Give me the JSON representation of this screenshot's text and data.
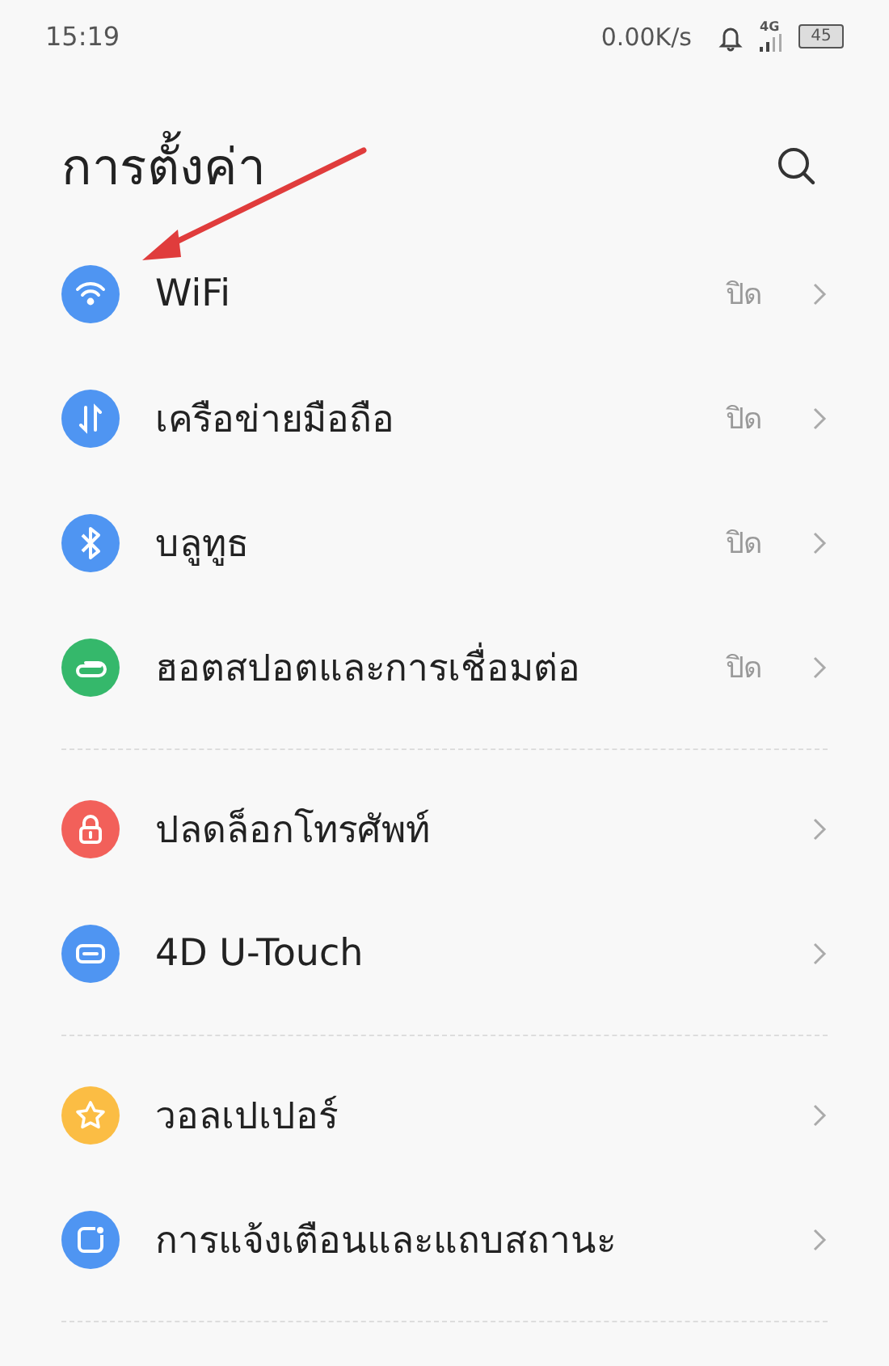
{
  "status_bar": {
    "time": "15:19",
    "speed": "0.00K/s",
    "network": "4G",
    "battery": "45"
  },
  "title": "การตั้งค่า",
  "sections": [
    {
      "items": [
        {
          "kind": "wifi",
          "label": "WiFi",
          "value": "ปิด",
          "color": "#4f95f2"
        },
        {
          "kind": "data",
          "label": "เครือข่ายมือถือ",
          "value": "ปิด",
          "color": "#4f95f2"
        },
        {
          "kind": "bluetooth",
          "label": "บลูทูธ",
          "value": "ปิด",
          "color": "#4f95f2"
        },
        {
          "kind": "hotspot",
          "label": "ฮอตสปอตและการเชื่อมต่อ",
          "value": "ปิด",
          "color": "#35b86b"
        }
      ]
    },
    {
      "items": [
        {
          "kind": "lock",
          "label": "ปลดล็อกโทรศัพท์",
          "color": "#f2605a"
        },
        {
          "kind": "touch",
          "label": "4D U-Touch",
          "color": "#4f95f2"
        }
      ]
    },
    {
      "items": [
        {
          "kind": "star",
          "label": "วอลเปเปอร์",
          "color": "#fbbd44"
        },
        {
          "kind": "notify",
          "label": "การแจ้งเตือนและแถบสถานะ",
          "color": "#4f95f2"
        }
      ]
    }
  ]
}
